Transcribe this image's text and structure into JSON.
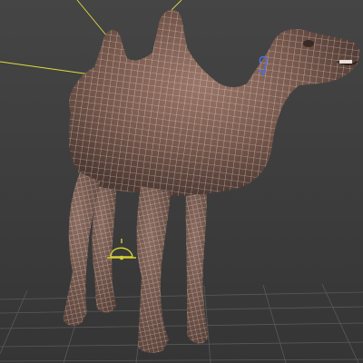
{
  "viewport": {
    "background_color": "#3e3e3e",
    "grid_color": "#5a5a5a"
  },
  "scene": {
    "model": {
      "name": "camel",
      "surface_color": "#7a5c50",
      "wireframe_color": "#e6e2df"
    },
    "light_lines_color": "#e0dc3c",
    "light_gizmo_color": "#d4d030",
    "selection_gizmo_color": "#4a6fe0"
  }
}
